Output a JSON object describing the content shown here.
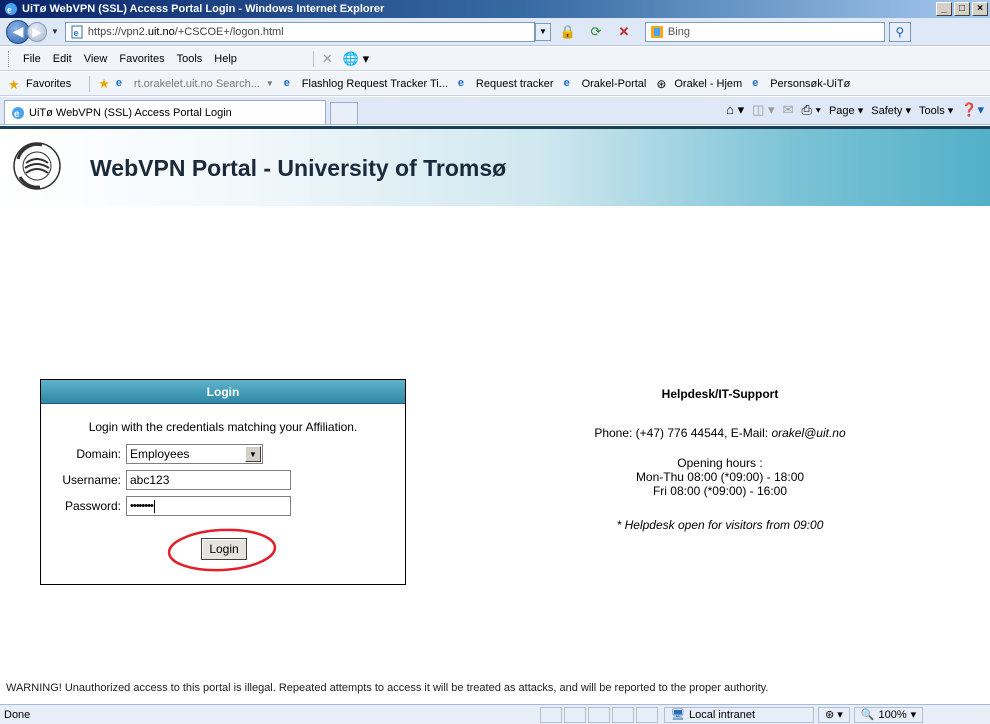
{
  "window": {
    "title": "UiTø WebVPN (SSL) Access Portal Login - Windows Internet Explorer",
    "minimize": "_",
    "maximize": "□",
    "close": "×"
  },
  "address_bar": {
    "url_prefix": "https://vpn2.",
    "url_domain": "uit.no",
    "url_suffix": "/+CSCOE+/logon.html",
    "search_placeholder": "Bing"
  },
  "menu": {
    "items": [
      "File",
      "Edit",
      "View",
      "Favorites",
      "Tools",
      "Help"
    ]
  },
  "favorites_bar": {
    "label": "Favorites",
    "items": [
      {
        "label": "rt.orakelet.uit.no Search...",
        "dim": true
      },
      {
        "label": "Flashlog Request Tracker Ti..."
      },
      {
        "label": "Request tracker"
      },
      {
        "label": "Orakel-Portal"
      },
      {
        "label": "Orakel - Hjem"
      },
      {
        "label": "Personsøk-UiTø"
      }
    ]
  },
  "tab": {
    "label": "UiTø WebVPN (SSL) Access Portal Login"
  },
  "command_bar": {
    "page": "Page",
    "safety": "Safety",
    "tools": "Tools"
  },
  "banner": {
    "title": "WebVPN Portal - University of Tromsø"
  },
  "login": {
    "heading": "Login",
    "intro": "Login with the credentials matching your Affiliation.",
    "domain_label": "Domain:",
    "domain_value": "Employees",
    "username_label": "Username:",
    "username_value": "abc123",
    "password_label": "Password:",
    "password_value": "••••••••",
    "button": "Login"
  },
  "helpdesk": {
    "title": "Helpdesk/IT-Support",
    "phone": "Phone: (+47) 776 44544, E-Mail: ",
    "email": "orakel@uit.no",
    "hours_title": "Opening hours :",
    "hours_weekdays": "Mon-Thu 08:00 (*09:00) - 18:00",
    "hours_friday": "Fri 08:00 (*09:00) - 16:00",
    "visitors": "* Helpdesk open for visitors from 09:00"
  },
  "warning": "WARNING! Unauthorized access to this portal is illegal. Repeated attempts to access it will be treated as attacks, and will be reported to the proper authority.",
  "status_bar": {
    "text": "Done",
    "zone": "Local intranet",
    "zoom": "100%"
  },
  "colors": {
    "banner_accent": "#52b0c8",
    "login_header": "#2e88a6",
    "highlight_ellipse": "#e0202a"
  }
}
